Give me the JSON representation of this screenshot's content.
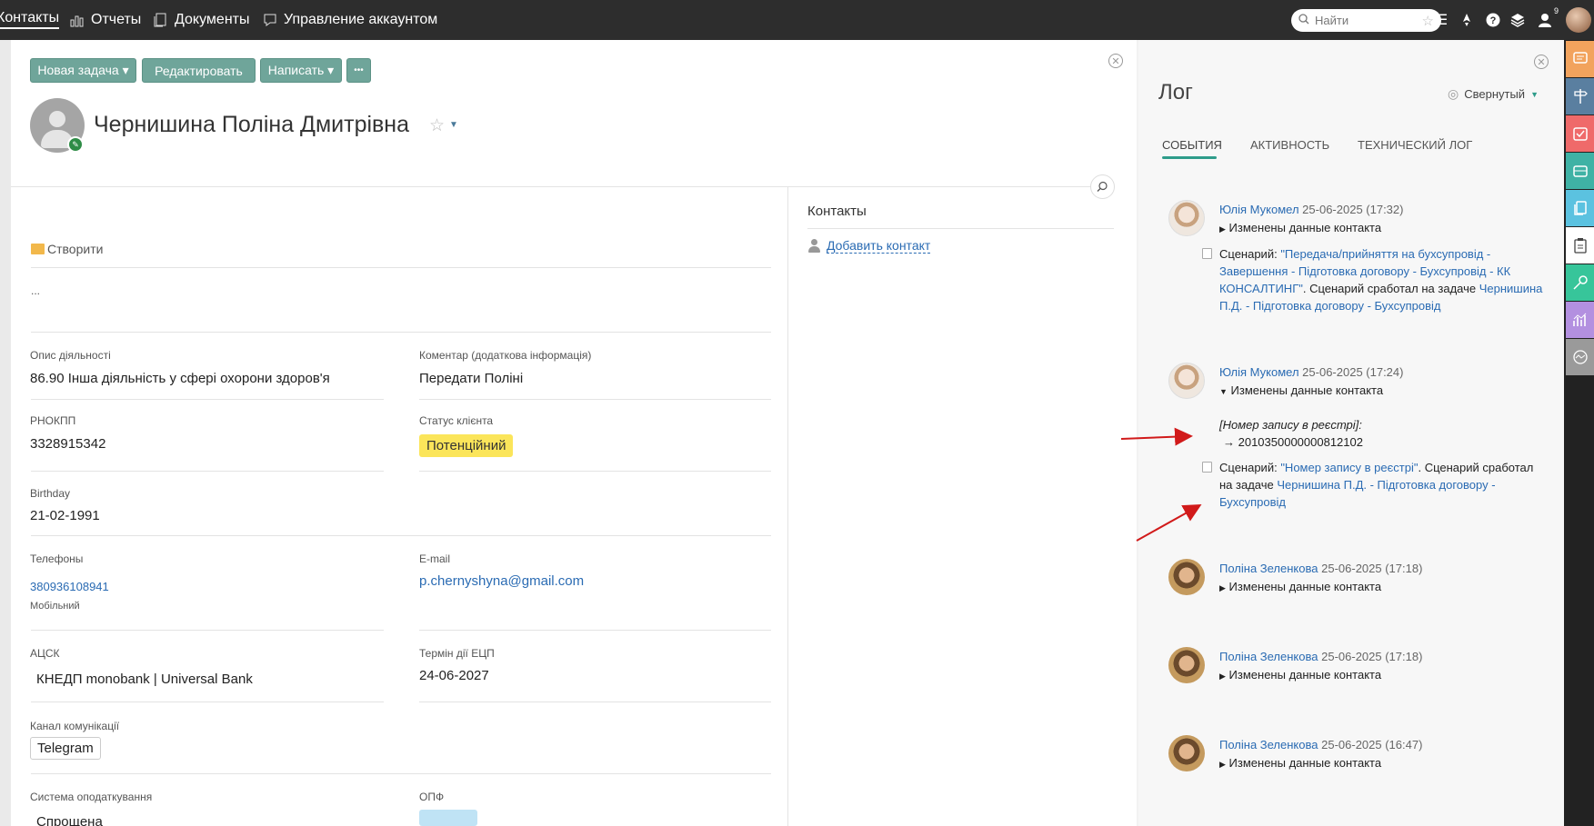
{
  "topbar": {
    "nav": [
      {
        "label": "Контакты",
        "icon": "none"
      },
      {
        "label": "Отчеты",
        "icon": "chart-icon"
      },
      {
        "label": "Документы",
        "icon": "documents-icon"
      },
      {
        "label": "Управление аккаунтом",
        "icon": "account-settings-icon"
      }
    ],
    "search_placeholder": "Найти",
    "notifications_count": "9"
  },
  "toolbar": {
    "new_task": "Новая задача ▾",
    "edit": "Редактировать",
    "write": "Написать ▾",
    "more": "•••"
  },
  "contact": {
    "name": "Чернишина Поліна Дмитрівна",
    "folder_label": "Створити",
    "ellipsis": "...",
    "fields": {
      "activity_label": "Опис діяльності",
      "activity_value": "86.90 Інша діяльність у сфері охорони здоров'я",
      "comment_label": "Коментар (додаткова інформація)",
      "comment_value": "Передати Поліні",
      "rnokpp_label": "РНОКПП",
      "rnokpp_value": "3328915342",
      "status_label": "Статус клієнта",
      "status_value": "Потенційний",
      "birthday_label": "Birthday",
      "birthday_value": "21-02-1991",
      "phones_label": "Телефоны",
      "phone_value": "380936108941",
      "phone_type": "Мобільний",
      "email_label": "E-mail",
      "email_value": "p.chernyshyna@gmail.com",
      "acsk_label": "АЦСК",
      "acsk_value": "КНЕДП monobank | Universal Bank",
      "ecp_label": "Термін дії ЕЦП",
      "ecp_value": "24-06-2027",
      "channel_label": "Канал комунікації",
      "channel_value": "Telegram",
      "tax_label": "Система оподаткування",
      "tax_value": "Спрощена",
      "opf_label": "ОПФ"
    },
    "contacts_section": {
      "title": "Контакты",
      "add_label": "Добавить контакт"
    }
  },
  "log": {
    "title": "Лог",
    "view_mode": "Свернутый",
    "tabs": [
      "СОБЫТИЯ",
      "АКТИВНОСТЬ",
      "ТЕХНИЧЕСКИЙ ЛОГ"
    ],
    "entries": [
      {
        "author": "Юлія Мукомел",
        "time": "25-06-2025 (17:32)",
        "header": "Изменены данные контакта",
        "scenario_prefix": "Сценарий: ",
        "scenario_link": "\"Передача/прийняття на бухсупровід - Завершення - Підготовка договору - Бухсупровід - КК КОНСАЛТИНГ\"",
        "scenario_mid": ". Сценарий сработал на задаче ",
        "task_link": "Чернишина П.Д. - Підготовка договору - Бухсупровід"
      },
      {
        "author": "Юлія Мукомел",
        "time": "25-06-2025 (17:24)",
        "header": "Изменены данные контакта",
        "change_field": "[Номер запису в реєстрі]:",
        "change_value": "→ 2010350000000812102",
        "scenario_prefix": "Сценарий: ",
        "scenario_link": "\"Номер запису в реєстрі\"",
        "scenario_mid": ". Сценарий сработал на задаче ",
        "task_link": "Чернишина П.Д. - Підготовка договору - Бухсупровід"
      },
      {
        "author": "Поліна Зеленкова",
        "time": "25-06-2025 (17:18)",
        "header": "Изменены данные контакта"
      },
      {
        "author": "Поліна Зеленкова",
        "time": "25-06-2025 (17:18)",
        "header": "Изменены данные контакта"
      },
      {
        "author": "Поліна Зеленкова",
        "time": "25-06-2025 (16:47)",
        "header": "Изменены данные контакта"
      }
    ]
  },
  "colors": {
    "topbar": "#2d2d2d",
    "button": "#6fa59a",
    "accent": "#2e9c8a",
    "link": "#2a6bb3",
    "status_tag": "#fbe55a",
    "annotation_arrow": "#d11a1a"
  }
}
